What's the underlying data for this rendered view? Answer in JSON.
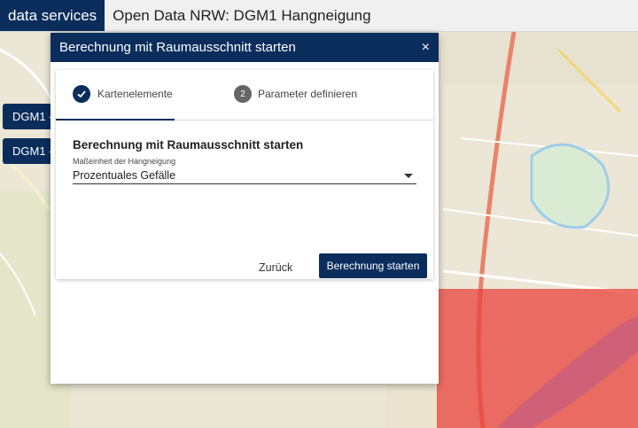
{
  "header": {
    "brand": "data services",
    "title": "Open Data NRW: DGM1 Hangneigung"
  },
  "sidebar_buttons": [
    {
      "label": "DGM1 -"
    },
    {
      "label": "DGM1 -"
    }
  ],
  "dialog": {
    "title": "Berechnung mit Raumausschnitt starten",
    "close_label": "×",
    "steps": [
      {
        "label": "Kartenelemente",
        "state": "done",
        "icon": "check-icon"
      },
      {
        "label": "Parameter definieren",
        "state": "active",
        "number": "2"
      }
    ],
    "form": {
      "heading": "Berechnung mit Raumausschnitt starten",
      "field_label": "Maßeinheit der Hangneigung",
      "selected_value": "Prozentuales Gefälle"
    },
    "actions": {
      "back_label": "Zurück",
      "start_label": "Berechnung starten"
    }
  },
  "map": {
    "highlight_color": "#e8423a",
    "accent_color": "#0a2d5c"
  }
}
